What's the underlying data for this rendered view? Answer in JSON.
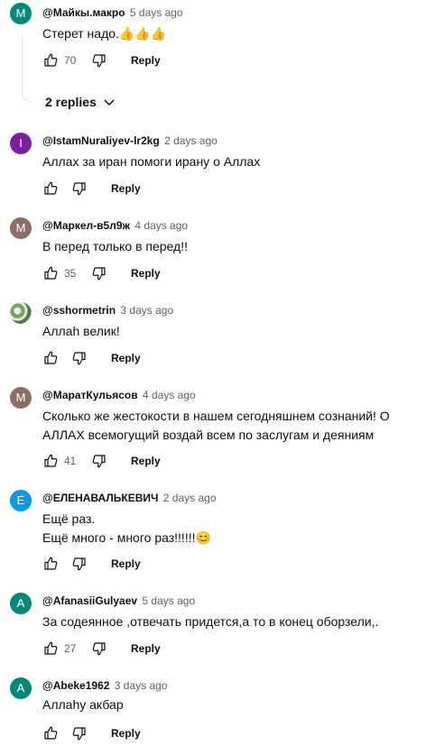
{
  "comments": [
    {
      "avatar_letter": "M",
      "avatar_color": "#00897b",
      "author": "@Майкы.макро",
      "time": "5 days ago",
      "lines": [
        "Стерет надо.👍👍👍"
      ],
      "likes": "70",
      "reply_label": "Reply"
    },
    {
      "avatar_letter": "I",
      "avatar_color": "#7b1fa2",
      "author": "@IstamNuraliyev-lr2kg",
      "time": "2 days ago",
      "lines": [
        "Аллах за иран помоги ирану о Аллах"
      ],
      "likes": "",
      "reply_label": "Reply"
    },
    {
      "avatar_letter": "M",
      "avatar_color": "#8d6e63",
      "author": "@Маркел-в5л9ж",
      "time": "4 days ago",
      "lines": [
        "В перед только в перед!!"
      ],
      "likes": "35",
      "reply_label": "Reply"
    },
    {
      "avatar_letter": "",
      "avatar_color": "#7aa06a",
      "author": "@sshormetrin",
      "time": "3 days ago",
      "lines": [
        "Аллah велик!"
      ],
      "likes": "",
      "reply_label": "Reply"
    },
    {
      "avatar_letter": "M",
      "avatar_color": "#8d6e63",
      "author": "@МаратКульясов",
      "time": "4 days ago",
      "lines": [
        "Сколько же жестокости в нашем сегодняшнем сознаний! О",
        "АЛЛАХ всемогущий воздай всем по заслугам и деяниям"
      ],
      "likes": "41",
      "reply_label": "Reply"
    },
    {
      "avatar_letter": "E",
      "avatar_color": "#039be5",
      "author": "@ЕЛЕНАВАЛЬКЕВИЧ",
      "time": "2 days ago",
      "lines": [
        "Ещё раз.",
        "Ещё много - много раз!!!!!!😊"
      ],
      "likes": "",
      "reply_label": "Reply"
    },
    {
      "avatar_letter": "A",
      "avatar_color": "#00897b",
      "author": "@AfanasiiGulyaev",
      "time": "5 days ago",
      "lines": [
        "За содеянное ,отвечать придется,а то в конец оборзели,."
      ],
      "likes": "27",
      "reply_label": "Reply"
    },
    {
      "avatar_letter": "A",
      "avatar_color": "#00897b",
      "author": "@Abeke1962",
      "time": "3 days ago",
      "lines": [
        "Аллаhу акбар"
      ],
      "likes": "",
      "reply_label": "Reply"
    }
  ],
  "thread": {
    "replies_label": "2 replies"
  }
}
